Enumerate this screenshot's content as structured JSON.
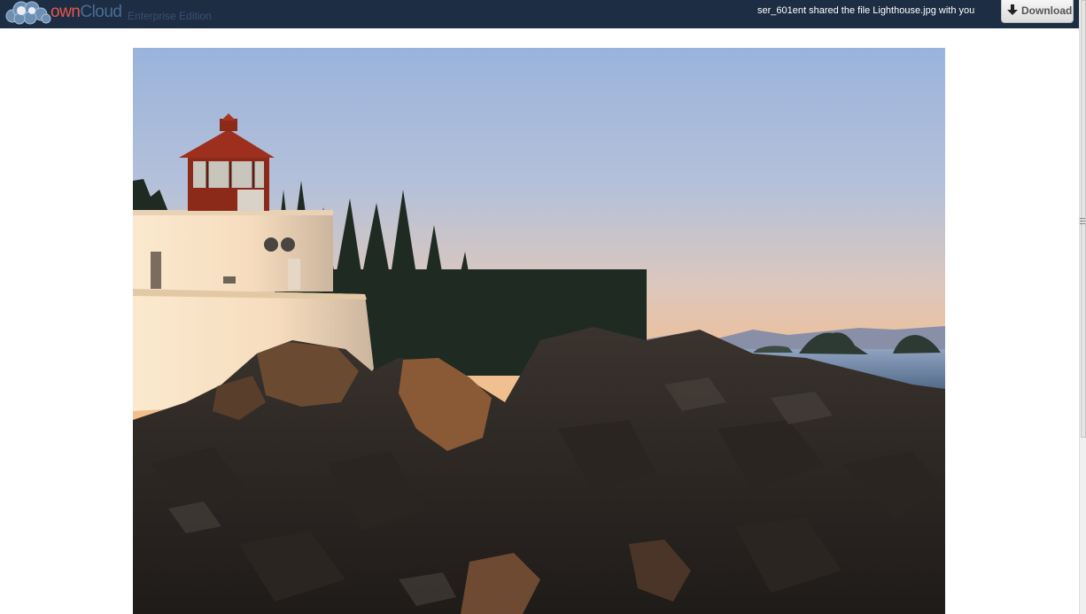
{
  "header": {
    "brand_own": "own",
    "brand_cloud": "Cloud",
    "edition": "Enterprise Edition",
    "share_message": "ser_601ent shared the file Lighthouse.jpg with you",
    "download_label": "Download",
    "download_icon": "download-arrow-icon",
    "logo_icon": "owncloud-cloud-icon"
  },
  "preview": {
    "image_subject": "lighthouse-on-rocky-coast-at-sunset"
  },
  "colors": {
    "header_bg": "#1d2d44",
    "brand_red": "#e2584a",
    "brand_blue": "#4b6d92"
  }
}
